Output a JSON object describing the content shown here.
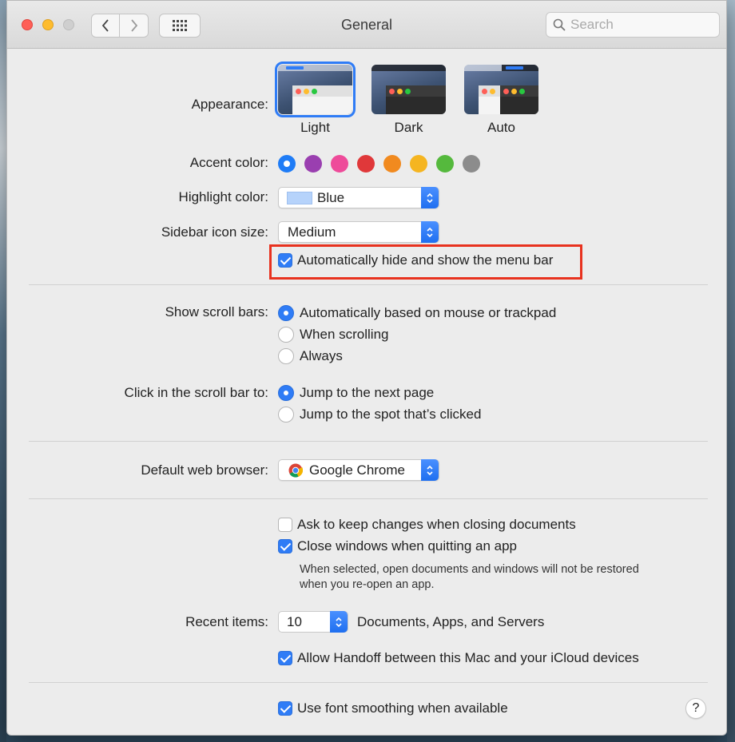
{
  "window": {
    "title": "General"
  },
  "search": {
    "placeholder": "Search"
  },
  "appearance": {
    "label": "Appearance:",
    "options": [
      {
        "label": "Light",
        "selected": true
      },
      {
        "label": "Dark",
        "selected": false
      },
      {
        "label": "Auto",
        "selected": false
      }
    ]
  },
  "accent": {
    "label": "Accent color:",
    "colors": [
      "#1f7cf6",
      "#9a3fb0",
      "#ee4b9a",
      "#e0383a",
      "#f18a1f",
      "#f5b521",
      "#55b93d",
      "#8c8c8c"
    ],
    "selected_index": 0
  },
  "highlight": {
    "label": "Highlight color:",
    "value": "Blue"
  },
  "sidebar": {
    "label": "Sidebar icon size:",
    "value": "Medium"
  },
  "menu_bar": {
    "label": "Automatically hide and show the menu bar",
    "checked": true
  },
  "scroll_bars": {
    "label": "Show scroll bars:",
    "options": [
      "Automatically based on mouse or trackpad",
      "When scrolling",
      "Always"
    ],
    "selected_index": 0
  },
  "click_scroll": {
    "label": "Click in the scroll bar to:",
    "options": [
      "Jump to the next page",
      "Jump to the spot that’s clicked"
    ],
    "selected_index": 0
  },
  "browser": {
    "label": "Default web browser:",
    "value": "Google Chrome"
  },
  "ask_keep": {
    "label": "Ask to keep changes when closing documents",
    "checked": false
  },
  "close_windows": {
    "label": "Close windows when quitting an app",
    "checked": true,
    "note_line1": "When selected, open documents and windows will not be restored",
    "note_line2": "when you re-open an app."
  },
  "recent": {
    "label": "Recent items:",
    "value": "10",
    "suffix": "Documents, Apps, and Servers"
  },
  "handoff": {
    "label": "Allow Handoff between this Mac and your iCloud devices",
    "checked": true
  },
  "font_smoothing": {
    "label": "Use font smoothing when available",
    "checked": true
  },
  "help": {
    "label": "?"
  }
}
